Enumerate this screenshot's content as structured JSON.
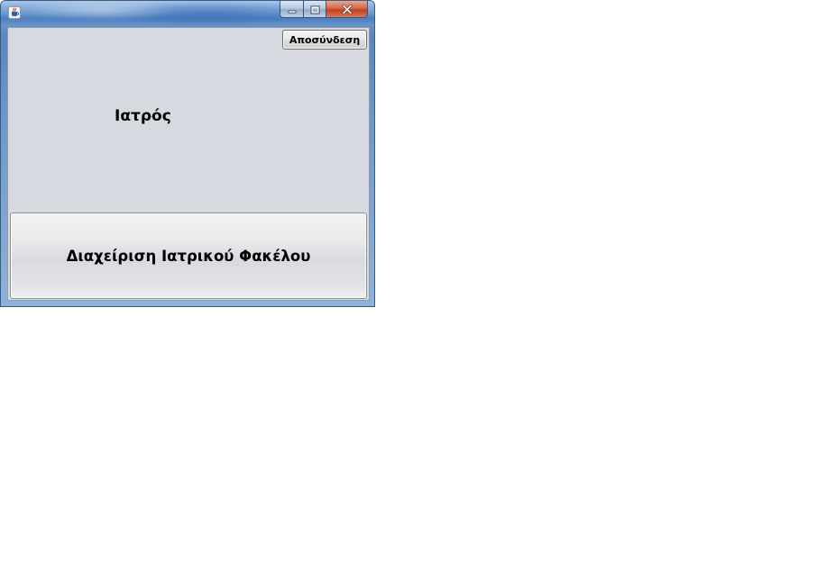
{
  "window": {
    "title": "",
    "app_icon": "java-cup-icon",
    "controls": {
      "minimize_icon": "minimize-icon",
      "maximize_icon": "maximize-icon",
      "close_icon": "close-icon"
    }
  },
  "header": {
    "logout_label": "Αποσύνδεση"
  },
  "main": {
    "role_label": "Ιατρός",
    "manage_records_label": "Διαχείριση Ιατρικού Φακέλου"
  },
  "colors": {
    "client_background": "#d6d9df",
    "close_button": "#c2401f",
    "titlebar_accent": "#4f7fbf"
  }
}
